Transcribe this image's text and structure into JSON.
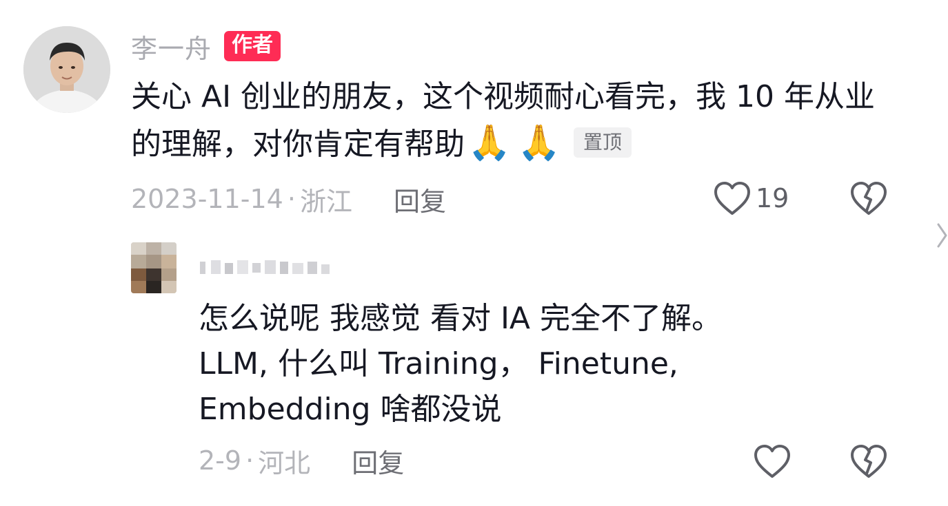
{
  "main_comment": {
    "author": "李一舟",
    "author_badge": "作者",
    "text": "关心 AI 创业的朋友，这个视频耐心看完，我 10 年从业的理解，对你肯定有帮助",
    "emoji": [
      "🙏",
      "🙏"
    ],
    "pin_badge": "置顶",
    "date": "2023-11-14",
    "separator": "·",
    "location": "浙江",
    "reply_label": "回复",
    "like_count": "19",
    "icons": {
      "like": "heart-outline-icon",
      "dislike": "broken-heart-icon",
      "expand": "chevron-right-icon"
    }
  },
  "reply_comment": {
    "text_lines": [
      "怎么说呢 我感觉 看对 IA 完全不了解。",
      "LLM, 什么叫 Training， Finetune,",
      "Embedding 啥都没说"
    ],
    "date": "2-9",
    "separator": "·",
    "location": "河北",
    "reply_label": "回复",
    "icons": {
      "like": "heart-outline-icon",
      "dislike": "broken-heart-icon",
      "avatar": "blurred-avatar",
      "name": "blurred-username"
    }
  },
  "colors": {
    "badge_red": "#fe2c55",
    "meta_gray": "#b3b4b9",
    "text_dark": "#161823",
    "pin_bg": "#f1f1f2"
  }
}
